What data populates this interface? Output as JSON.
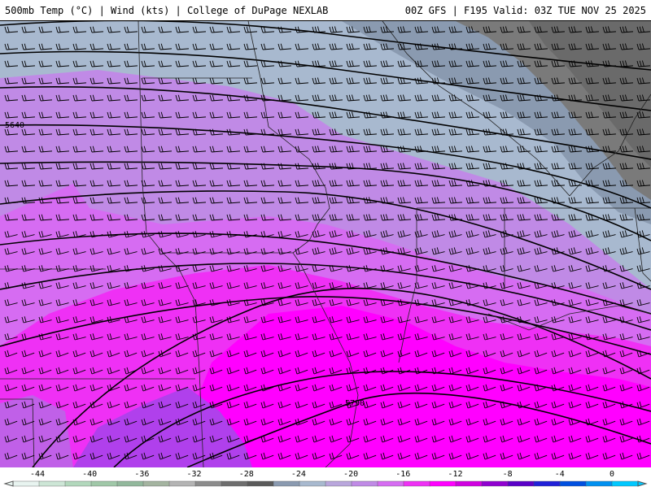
{
  "header": {
    "left_title": "500mb Temp (°C) | Wind (kts) | College of DuPage NEXLAB",
    "right_title": "00Z GFS | F195 Valid: 03Z TUE NOV 25 2025"
  },
  "map": {
    "contour_labels": [
      "5640",
      "5790"
    ],
    "colors": {
      "gray_dark": "#6e6e6e",
      "gray_light": "#a8b9cf",
      "lavender": "#c08ae6",
      "violet": "#d66cf2",
      "magenta": "#ef30f5",
      "hot_magenta": "#ff00ff",
      "deep_violet": "#a040e8"
    }
  },
  "colorbar": {
    "tick_labels": [
      "-44",
      "-40",
      "-36",
      "-32",
      "-28",
      "-24",
      "-20",
      "-16",
      "-12",
      "-8",
      "-4",
      "0"
    ],
    "colors": [
      "#e8f4f0",
      "#cde6d6",
      "#b2d8bc",
      "#a0c8a8",
      "#92b89c",
      "#a4b4a0",
      "#b4b4b4",
      "#8c8c8c",
      "#6e6e6e",
      "#5a5a5a",
      "#8a9ab0",
      "#a8b9cf",
      "#b9a6dc",
      "#c08ae6",
      "#d66cf2",
      "#ef30f5",
      "#ff00ff",
      "#d000e0",
      "#9000d0",
      "#5a00c8",
      "#2020d8",
      "#0050e0",
      "#0090f0",
      "#00c8ff"
    ]
  }
}
